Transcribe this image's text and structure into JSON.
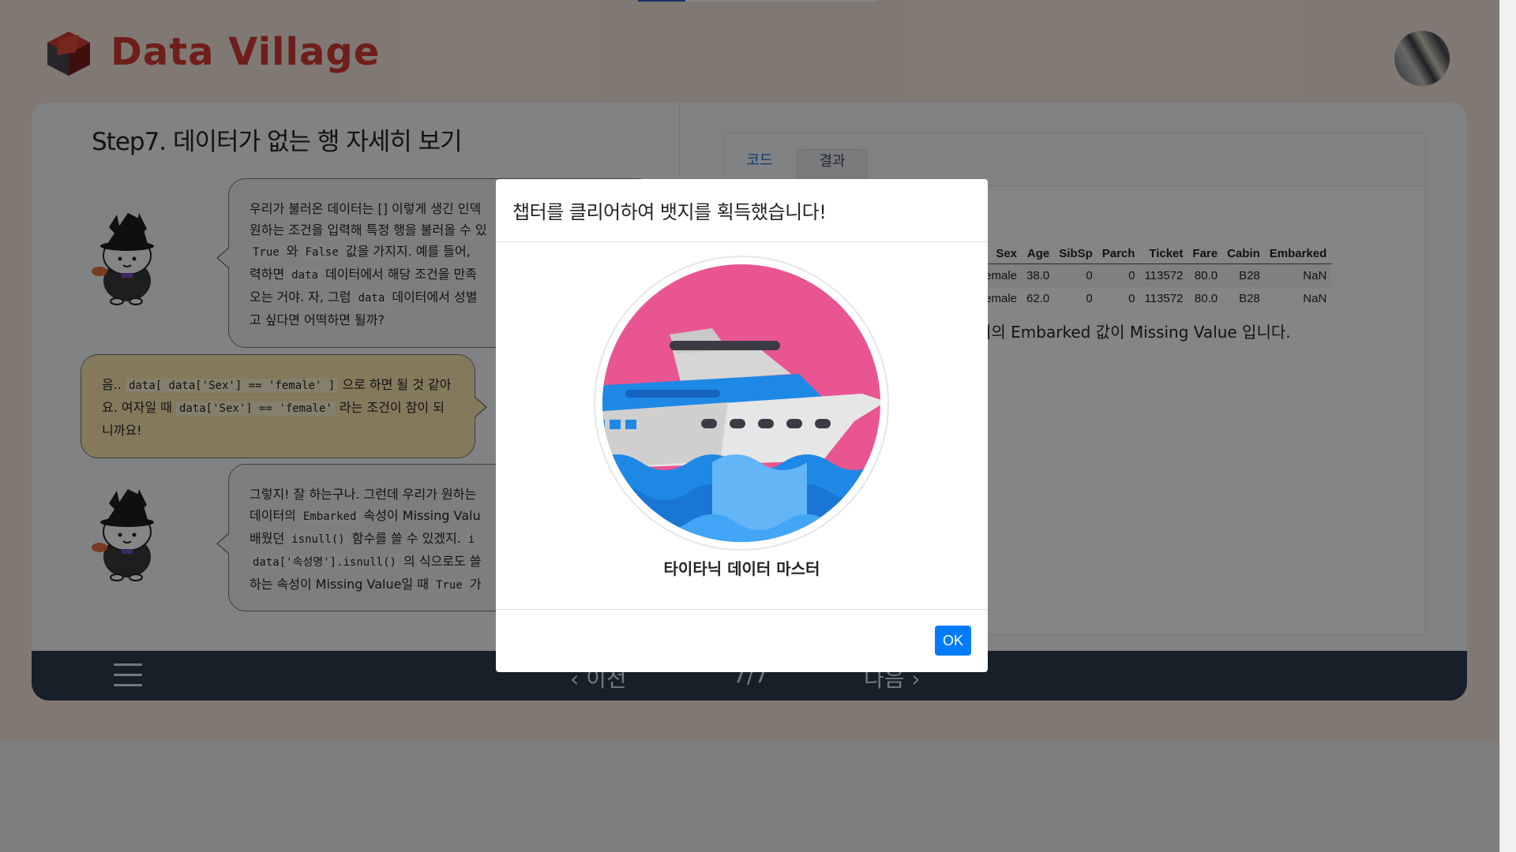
{
  "app": {
    "brand": "Data Village"
  },
  "lesson": {
    "title": "Step7. 데이터가 없는 행 자세히 보기",
    "dialogue": [
      {
        "speaker": "teacher",
        "parts": [
          {
            "t": "우리가 불러온 데이터는 [] 이렇게 생긴 인덱"
          },
          {
            "t": "원하는 조건을 입력해 특정 행을 불러올 수 있"
          },
          {
            "c": "True"
          },
          {
            "t": " 와 "
          },
          {
            "c": "False"
          },
          {
            "t": " 값을 가지지. 예를 들어,"
          },
          {
            "t": "력하면 "
          },
          {
            "c": "data"
          },
          {
            "t": " 데이터에서 해당 조건을 만족"
          },
          {
            "t": "오는 거야. 자, 그럼 "
          },
          {
            "c": "data"
          },
          {
            "t": " 데이터에서 성별"
          },
          {
            "t": "고 싶다면 어떡하면 될까?"
          }
        ]
      },
      {
        "speaker": "student",
        "parts": [
          {
            "t": "음.. "
          },
          {
            "c": "data[ data['Sex'] == 'female' ]"
          },
          {
            "t": " 으로 하면 될 것 같아요. 여자일 때 "
          },
          {
            "c": "data['Sex'] == 'female'"
          },
          {
            "t": " 라는 조건이 참이 되니까요!"
          }
        ]
      },
      {
        "speaker": "teacher",
        "parts": [
          {
            "t": "그렇지! 잘 하는구나. 그런데 우리가 원하는"
          },
          {
            "t": "데이터의 "
          },
          {
            "c": "Embarked"
          },
          {
            "t": " 속성이 Missing Valu"
          },
          {
            "t": "배웠던 "
          },
          {
            "c": "isnull()"
          },
          {
            "t": " 함수를 쓸 수 있겠지. "
          },
          {
            "c": "i"
          },
          {
            "c": "data['속성명'].isnull()"
          },
          {
            "t": " 의 식으로도 쓸"
          },
          {
            "t": "하는 속성이 Missing Value일 때 "
          },
          {
            "c": "True"
          },
          {
            "t": " 가"
          }
        ]
      }
    ]
  },
  "code_panel": {
    "tabs": [
      "코드",
      "결과"
    ],
    "table": {
      "columns": [
        "Sex",
        "Age",
        "SibSp",
        "Parch",
        "Ticket",
        "Fare",
        "Cabin",
        "Embarked"
      ],
      "rows": [
        [
          "female",
          "38.0",
          "0",
          "0",
          "113572",
          "80.0",
          "B28",
          "NaN"
        ],
        [
          "female",
          "62.0",
          "0",
          "0",
          "113572",
          "80.0",
          "B28",
          "NaN"
        ]
      ]
    },
    "result_text": "터의 Embarked 값이 Missing Value 입니다."
  },
  "bottom_nav": {
    "prev": "이전",
    "page": "7/7",
    "next": "다음"
  },
  "modal": {
    "title": "챕터를 클리어하여 뱃지를 획득했습니다!",
    "badge_label": "타이타닉 데이터 마스터",
    "ok_label": "OK"
  },
  "colors": {
    "brand_red": "#d43d34",
    "bottom_bar": "#2c3e50",
    "ok_button": "#007bff",
    "badge_pink": "#e95591",
    "badge_blue": "#1e88e5"
  }
}
